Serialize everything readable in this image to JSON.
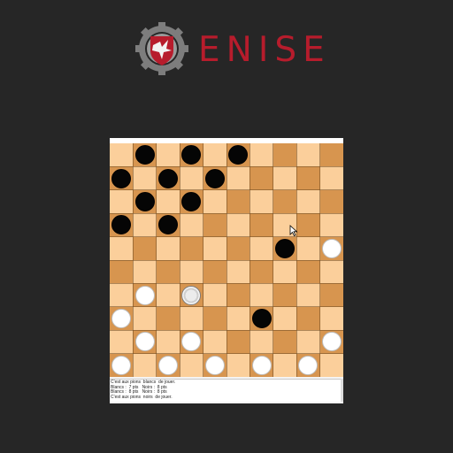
{
  "logo": {
    "text": "ENISE",
    "icon": "gear-shield-eagle-icon",
    "color": "#b71c2c"
  },
  "board": {
    "size": 10,
    "light_color": "#fbcf9b",
    "dark_color": "#d7954f",
    "black_pieces": [
      [
        0,
        1
      ],
      [
        0,
        3
      ],
      [
        0,
        5
      ],
      [
        1,
        0
      ],
      [
        1,
        2
      ],
      [
        1,
        4
      ],
      [
        2,
        1
      ],
      [
        2,
        3
      ],
      [
        3,
        0
      ],
      [
        3,
        2
      ],
      [
        4,
        7
      ],
      [
        7,
        6
      ]
    ],
    "white_pieces": [
      [
        4,
        9
      ],
      [
        6,
        1
      ],
      [
        7,
        0
      ],
      [
        8,
        1
      ],
      [
        8,
        3
      ],
      [
        8,
        9
      ],
      [
        9,
        0
      ],
      [
        9,
        2
      ],
      [
        9,
        4
      ],
      [
        9,
        6
      ],
      [
        9,
        8
      ]
    ],
    "selected_piece": [
      6,
      3
    ]
  },
  "log": {
    "lines": [
      "C'est aux pions  blancs  de jouer.",
      "Blancs :  7 pts   Noirs :  8 pts",
      "Blancs :  8 pts   Noirs :  8 pts",
      "C'est aux pions  noirs  de jouer."
    ]
  }
}
